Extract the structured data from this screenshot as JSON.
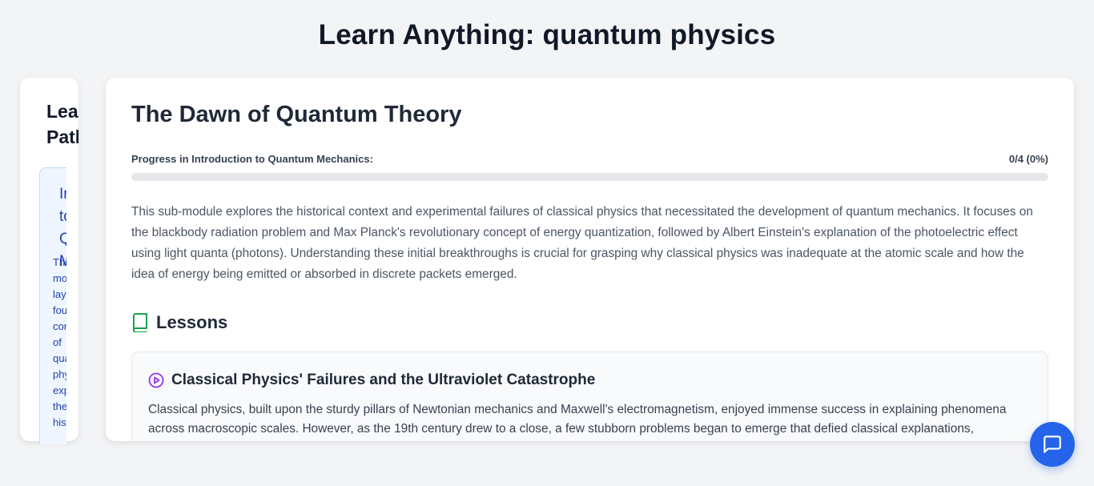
{
  "page": {
    "title": "Learn Anything: quantum physics"
  },
  "sidebar": {
    "title": "Learning Path",
    "module": {
      "title": "Introduction to Quantum Mechanics",
      "description": "This module lays the foundational concepts of quantum physics, exploring the historical"
    }
  },
  "main": {
    "submodule_title": "The Dawn of Quantum Theory",
    "progress": {
      "label": "Progress in Introduction to Quantum Mechanics:",
      "value_text": "0/4 (0%)",
      "completed": 0,
      "total": 4,
      "percent": 0,
      "color": "#3b82f6"
    },
    "description": "This sub-module explores the historical context and experimental failures of classical physics that necessitated the development of quantum mechanics. It focuses on the blackbody radiation problem and Max Planck's revolutionary concept of energy quantization, followed by Albert Einstein's explanation of the photoelectric effect using light quanta (photons). Understanding these initial breakthroughs is crucial for grasping why classical physics was inadequate at the atomic scale and how the idea of energy being emitted or absorbed in discrete packets emerged.",
    "lessons_heading": "Lessons",
    "lessons_icon": "book-icon",
    "lessons": [
      {
        "title": "Classical Physics' Failures and the Ultraviolet Catastrophe",
        "icon": "play-circle-icon",
        "body": "Classical physics, built upon the sturdy pillars of Newtonian mechanics and Maxwell's electromagnetism, enjoyed immense success in explaining phenomena across macroscopic scales. However, as the 19th century drew to a close, a few stubborn problems began to emerge that defied classical explanations,"
      }
    ]
  },
  "chat": {
    "icon": "chat-bubble-icon",
    "color": "#2563eb"
  }
}
